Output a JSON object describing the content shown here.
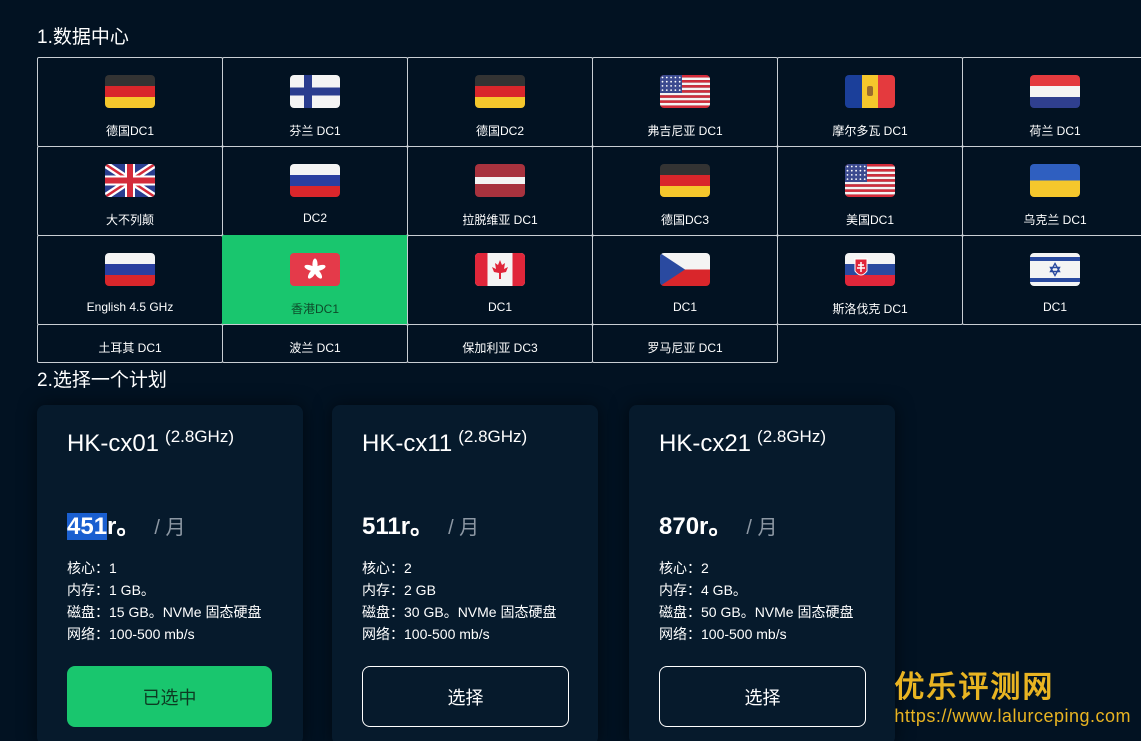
{
  "sections": {
    "datacenter_title": "1.数据中心",
    "plan_title": "2.选择一个计划"
  },
  "datacenters": [
    {
      "label": "德国DC1",
      "flag": "germany-flag",
      "selected": false
    },
    {
      "label": "芬兰 DC1",
      "flag": "finland-flag",
      "selected": false
    },
    {
      "label": "德国DC2",
      "flag": "germany-flag",
      "selected": false
    },
    {
      "label": "弗吉尼亚 DC1",
      "flag": "usa-flag",
      "selected": false
    },
    {
      "label": "摩尔多瓦 DC1",
      "flag": "moldova-flag",
      "selected": false
    },
    {
      "label": "荷兰 DC1",
      "flag": "netherlands-flag",
      "selected": false
    },
    {
      "label": "大不列颠",
      "flag": "uk-flag",
      "selected": false
    },
    {
      "label": "DC2",
      "flag": "russia-flag",
      "selected": false
    },
    {
      "label": "拉脱维亚 DC1",
      "flag": "latvia-flag",
      "selected": false
    },
    {
      "label": "德国DC3",
      "flag": "germany-flag",
      "selected": false
    },
    {
      "label": "美国DC1",
      "flag": "usa-flag",
      "selected": false
    },
    {
      "label": "乌克兰 DC1",
      "flag": "ukraine-flag",
      "selected": false
    },
    {
      "label": "English 4.5 GHz",
      "flag": "russia-flag",
      "selected": false
    },
    {
      "label": "香港DC1",
      "flag": "hongkong-flag",
      "selected": true
    },
    {
      "label": "DC1",
      "flag": "canada-flag",
      "selected": false
    },
    {
      "label": "DC1",
      "flag": "czech-flag",
      "selected": false
    },
    {
      "label": "斯洛伐克 DC1",
      "flag": "slovakia-flag",
      "selected": false
    },
    {
      "label": "DC1",
      "flag": "israel-flag",
      "selected": false
    },
    {
      "label": "土耳其 DC1",
      "flag": "",
      "selected": false
    },
    {
      "label": "波兰 DC1",
      "flag": "",
      "selected": false
    },
    {
      "label": "保加利亚 DC3",
      "flag": "",
      "selected": false
    },
    {
      "label": "罗马尼亚 DC1",
      "flag": "",
      "selected": false
    }
  ],
  "plans": [
    {
      "name": "HK-cx01",
      "freq": "(2.8GHz)",
      "price_num": "451",
      "price_suffix": "r。",
      "period": "/ 月",
      "specs": [
        "核心：1",
        "内存：1 GB。",
        "磁盘：15 GB。NVMe 固态硬盘",
        "网络：100-500 mb/s"
      ],
      "button": "已选中",
      "selected": true
    },
    {
      "name": "HK-cx11",
      "freq": "(2.8GHz)",
      "price_num": "511",
      "price_suffix": "r。",
      "period": "/ 月",
      "specs": [
        "核心：2",
        "内存：2 GB",
        "磁盘：30 GB。NVMe 固态硬盘",
        "网络：100-500 mb/s"
      ],
      "button": "选择",
      "selected": false
    },
    {
      "name": "HK-cx21",
      "freq": "(2.8GHz)",
      "price_num": "870",
      "price_suffix": "r。",
      "period": "/ 月",
      "specs": [
        "核心：2",
        "内存：4 GB。",
        "磁盘：50 GB。NVMe 固态硬盘",
        "网络：100-500 mb/s"
      ],
      "button": "选择",
      "selected": false
    }
  ],
  "watermark": {
    "brand": "优乐评测网",
    "url": "https://www.lalurceping.com"
  }
}
